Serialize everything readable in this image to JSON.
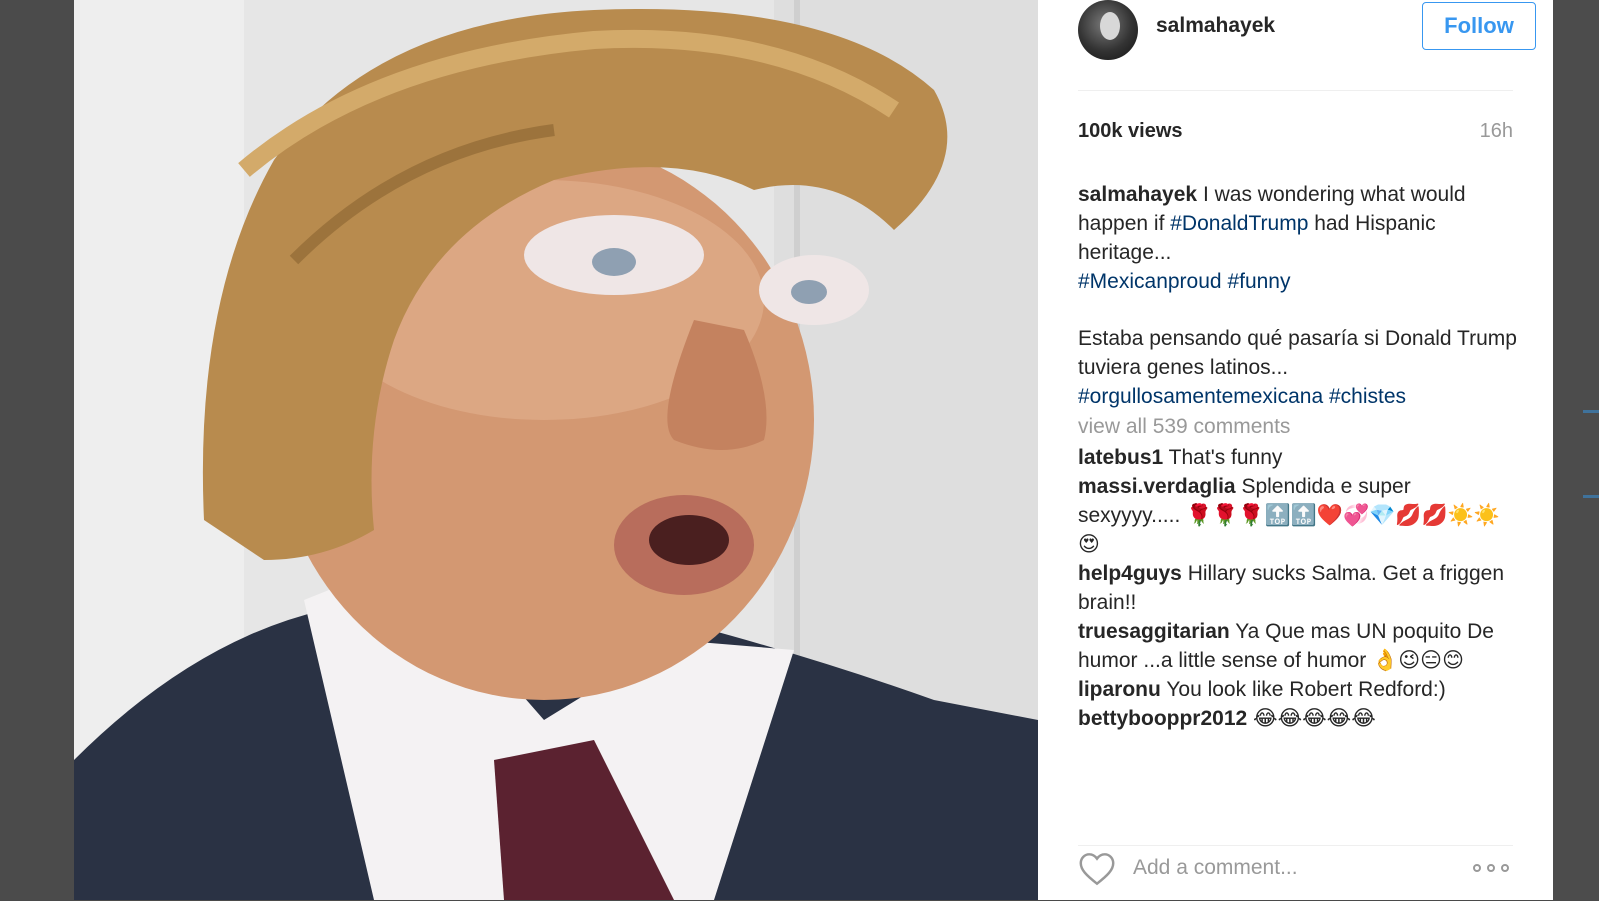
{
  "post": {
    "username": "salmahayek",
    "follow_label": "Follow",
    "views": "100k views",
    "time_ago": "16h",
    "caption": {
      "en_part1": "I was wondering what would happen if ",
      "tag_donaldtrump": "#DonaldTrump",
      "en_part2": " had Hispanic heritage...",
      "tag_mexicanproud": "#Mexicanproud",
      "tag_funny": "#funny",
      "es_text": "Estaba pensando qué pasaría si Donald Trump tuviera genes latinos...",
      "tag_orgullo": "#orgullosamentemexicana",
      "tag_chistes": "#chistes"
    },
    "view_all_comments": "view all 539 comments"
  },
  "comments": [
    {
      "user": "latebus1",
      "text": "That's funny"
    },
    {
      "user": "massi.verdaglia",
      "text": "Splendida e super sexyyyy..... 🌹🌹🌹🔝🔝❤️💞💎💋💋☀️☀️😍"
    },
    {
      "user": "help4guys",
      "text": "Hillary sucks Salma. Get a friggen brain!!"
    },
    {
      "user": "truesaggitarian",
      "text": "Ya Que mas UN poquito De humor ...a little sense of humor 👌😉😑😊"
    },
    {
      "user": "liparonu",
      "text": "You look like Robert Redford:)"
    },
    {
      "user": "bettybooppr2012",
      "text": "😂😂😂😂😂"
    }
  ],
  "actions": {
    "add_comment_placeholder": "Add a comment...",
    "like_icon": "heart-icon",
    "more_icon": "more-options-icon"
  },
  "colors": {
    "follow_blue": "#3897f0",
    "hashtag_blue": "#003569",
    "muted_gray": "#999999",
    "text_dark": "#262626"
  }
}
